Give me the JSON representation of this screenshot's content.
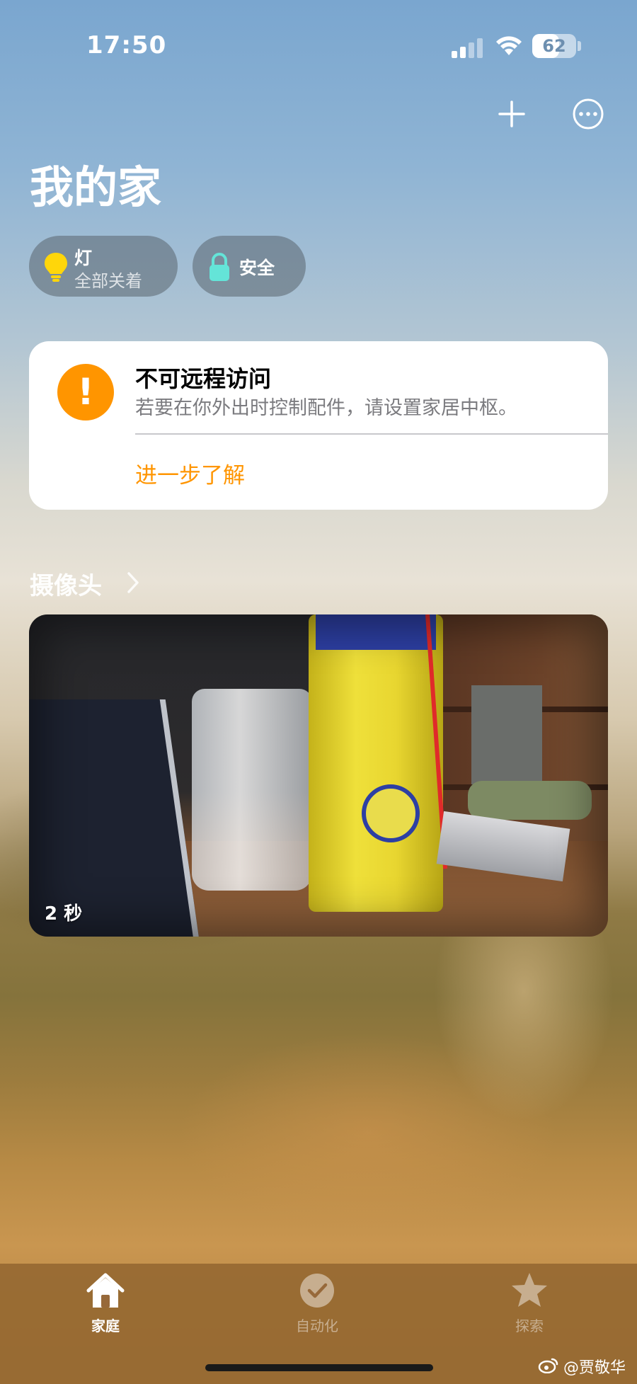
{
  "status_bar": {
    "time": "17:50",
    "battery_level": "62",
    "battery_fraction": 0.62
  },
  "header": {
    "title": "我的家",
    "add_icon": "plus-icon",
    "more_icon": "ellipsis-circle-icon"
  },
  "chips": {
    "lights": {
      "title": "灯",
      "subtitle": "全部关着",
      "icon": "lightbulb-icon",
      "icon_color": "#ffd60a"
    },
    "security": {
      "title": "安全",
      "icon": "lock-icon",
      "icon_color": "#64e4d8"
    }
  },
  "alert": {
    "icon": "exclamation-icon",
    "accent_color": "#ff9500",
    "title": "不可远程访问",
    "body": "若要在你外出时控制配件，请设置家居中枢。",
    "link": "进一步了解"
  },
  "cameras": {
    "section_title": "摄像头",
    "tile": {
      "timestamp": "2 秒"
    }
  },
  "tab_bar": {
    "tabs": [
      {
        "label": "家庭",
        "icon": "house-icon",
        "active": true
      },
      {
        "label": "自动化",
        "icon": "clock-check-icon",
        "active": false
      },
      {
        "label": "探索",
        "icon": "star-icon",
        "active": false
      }
    ]
  },
  "watermark": {
    "icon": "weibo-icon",
    "text": "@贾敬华"
  }
}
